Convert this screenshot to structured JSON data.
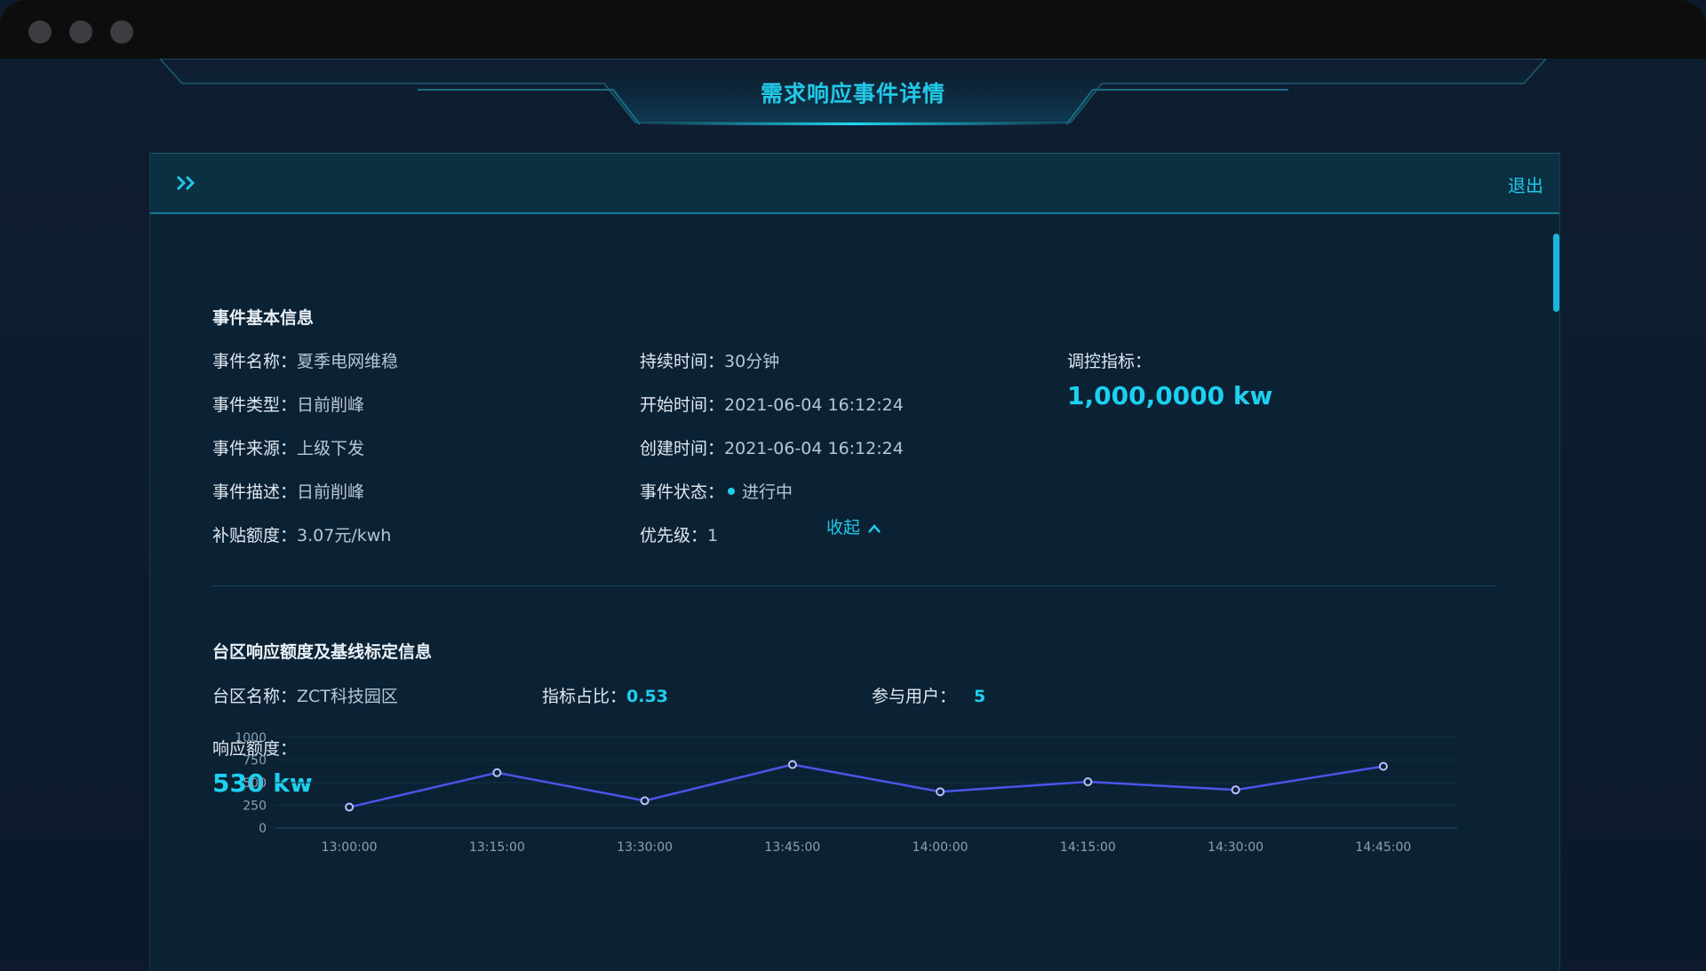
{
  "page": {
    "title": "需求响应事件详情"
  },
  "header": {
    "exit_label": "退出",
    "toggle_icon": "double-chevron-right-icon"
  },
  "event_info": {
    "section_title": "事件基本信息",
    "fields": [
      {
        "label": "事件名称：",
        "value": "夏季电网维稳"
      },
      {
        "label": "事件类型：",
        "value": "日前削峰"
      },
      {
        "label": "事件来源：",
        "value": "上级下发"
      },
      {
        "label": "事件描述：",
        "value": "日前削峰"
      },
      {
        "label": "补贴额度：",
        "value": "3.07元/kwh"
      },
      {
        "label": "持续时间：",
        "value": "30分钟"
      },
      {
        "label": "开始时间：",
        "value": "2021-06-04 16:12:24"
      },
      {
        "label": "创建时间：",
        "value": "2021-06-04 16:12:24"
      },
      {
        "label": "事件状态：",
        "value": "进行中"
      },
      {
        "label": "优先级：",
        "value": "1"
      }
    ],
    "control_index": {
      "label": "调控指标：",
      "value": "1,000,0000 kw"
    },
    "collapse_label": "收起"
  },
  "area_info": {
    "section_title": "台区响应额度及基线标定信息",
    "area_name": {
      "label": "台区名称：",
      "value": "ZCT科技园区"
    },
    "index_ratio": {
      "label": "指标占比：",
      "value": "0.53"
    },
    "participants": {
      "label": "参与用户：",
      "value": "5"
    },
    "response": {
      "label": "响应额度：",
      "value": "530 kw"
    }
  },
  "colors": {
    "accent": "#1dd0ef",
    "status_dot": "#1fd0e8",
    "line": "#4a55e8"
  },
  "chart_data": {
    "type": "line",
    "x": [
      "13:00:00",
      "13:15:00",
      "13:30:00",
      "13:45:00",
      "14:00:00",
      "14:15:00",
      "14:30:00",
      "14:45:00"
    ],
    "series": [
      {
        "values": [
          230,
          610,
          300,
          700,
          400,
          510,
          420,
          680
        ]
      }
    ],
    "y_ticks": [
      "0",
      "250",
      "500",
      "750",
      "1000"
    ],
    "ylim": [
      0,
      1000
    ],
    "grid": true
  }
}
